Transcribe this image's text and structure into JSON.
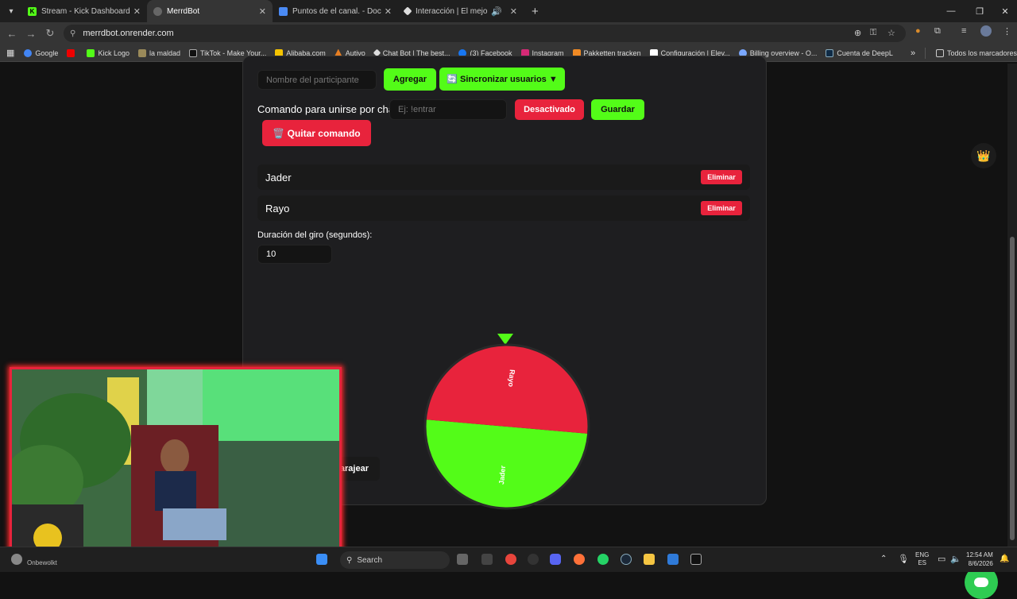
{
  "browser": {
    "tabs": [
      {
        "title": "Stream - Kick Dashboard",
        "active": false
      },
      {
        "title": "MerrdBot",
        "active": true
      },
      {
        "title": "Puntos de el canal. - Document",
        "active": false
      },
      {
        "title": "Interacción | El mejor softw",
        "active": false
      }
    ],
    "url": "merrdbot.onrender.com",
    "bookmarks": [
      "Google",
      "",
      "Kick Logo",
      "la maldad",
      "TikTok - Make Your...",
      "Alibaba.com",
      "Autivo",
      "Chat Bot | The best...",
      "(3) Facebook",
      "Instagram",
      "Pakketten tracken",
      "Configuración | Elev...",
      "Billing overview - O...",
      "Cuenta de DeepL"
    ],
    "all_bookmarks": "Todos los marcadores"
  },
  "app": {
    "participant_placeholder": "Nombre del participante",
    "add_label": "Agregar",
    "sync_label": "🔄 Sincronizar usuarios ▼",
    "command_label": "Comando para unirse por chat:",
    "command_placeholder": "Ej: !entrar",
    "deactivated_label": "Desactivado",
    "save_label": "Guardar",
    "remove_command_label": "🗑️ Quitar comando",
    "participants": [
      {
        "name": "Jader",
        "delete_label": "Eliminar",
        "color": "#53fc18"
      },
      {
        "name": "Rayo",
        "delete_label": "Eliminar",
        "color": "#e8233c"
      }
    ],
    "duration_label": "Duración del giro (segundos):",
    "duration_value": "10",
    "shuffle_label": "Barajear"
  },
  "colors": {
    "accent_green": "#53fc18",
    "accent_red": "#e8233c"
  },
  "taskbar": {
    "weather_label": "Onbewolkt",
    "search_placeholder": "Search",
    "lang_top": "ENG",
    "lang_bottom": "ES",
    "time": "12:54 AM",
    "date": "8/6/2026"
  }
}
